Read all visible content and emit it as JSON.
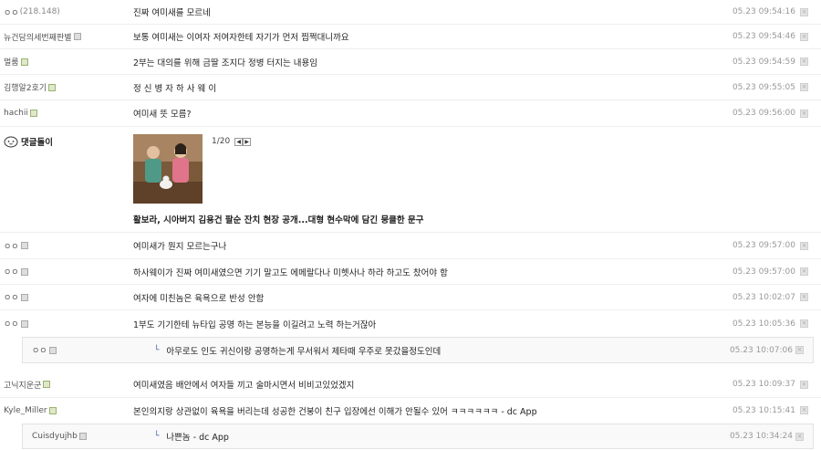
{
  "comments": [
    {
      "nick": "ㅇㅇ",
      "ip": "(218.148)",
      "icon": "",
      "msg": "진짜 여미새를 모르네",
      "date": "05.23 09:54:16"
    },
    {
      "nick": "뉴건담의세번째판별",
      "ip": "",
      "icon": "gray",
      "msg": "보통 여미새는 이여자 저여자한테 자기가 먼저 찝쩍대니까요",
      "date": "05.23 09:54:46"
    },
    {
      "nick": "멀룸",
      "ip": "",
      "icon": "green",
      "msg": "2부는 대의를 위해 금딸 조지다 정병 터지는 내용임",
      "date": "05.23 09:54:59"
    },
    {
      "nick": "김행알2호기",
      "ip": "",
      "icon": "green",
      "msg": "정 신 병 자 하 사 웨 이",
      "date": "05.23 09:55:05"
    },
    {
      "nick": "hachii",
      "ip": "",
      "icon": "green",
      "msg": "여미새 뜻 모름?",
      "date": "05.23 09:56:00"
    },
    {
      "nick": "ㅇㅇ",
      "ip": "",
      "icon": "gray",
      "msg": "여미새가 뭔지 모르는구나",
      "date": "05.23 09:57:00"
    },
    {
      "nick": "ㅇㅇ",
      "ip": "",
      "icon": "gray",
      "msg": "하사웨이가 진짜 여미새였으면 기기 말고도 에메랄다나 미헷사나 하라 하고도 찼어야 함",
      "date": "05.23 09:57:00"
    },
    {
      "nick": "ㅇㅇ",
      "ip": "",
      "icon": "gray",
      "msg": "여자에 미친놈은 육욕으로 반성 안함",
      "date": "05.23 10:02:07"
    },
    {
      "nick": "ㅇㅇ",
      "ip": "",
      "icon": "gray",
      "msg": "1부도 기기한테 뉴타입 공명 하는 본능을 이길려고 노력 하는거잖아",
      "date": "05.23 10:05:36"
    },
    {
      "nick": "ㅇㅇ",
      "ip": "",
      "icon": "gray",
      "msg": "아무로도 인도 귀신이랑 공명하는게 무서워서 제타때 우주로 못갔을정도인데",
      "date": "05.23 10:07:06"
    },
    {
      "nick": "고닉지운군",
      "ip": "",
      "icon": "green",
      "msg": "여미새였음 배안에서 여자들 끼고 술마시면서 비비고있었겠지",
      "date": "05.23 10:09:37"
    },
    {
      "nick": "Kyle_Miller",
      "ip": "",
      "icon": "green",
      "msg": "본인의지랑 상관없이 육욕을 버리는데 성공한 건붕이 친구 입장에선 이해가 안될수 있어 ㅋㅋㅋㅋㅋㅋ - dc App",
      "date": "05.23 10:15:41"
    },
    {
      "nick": "Cuisdyujhb",
      "ip": "",
      "icon": "gray",
      "msg": "나쁜놈 - dc App",
      "date": "05.23 10:34:24"
    }
  ],
  "ad": {
    "who": "댓글돌이",
    "pager": "1/20",
    "prev": "◀",
    "next": "▶",
    "headline": "활보라, 시아버지 김용건 팔순 잔치 현장 공개...대형 현수막에 담긴 뭉클한 문구"
  },
  "reply_mark": "└",
  "delete_mark": "×"
}
